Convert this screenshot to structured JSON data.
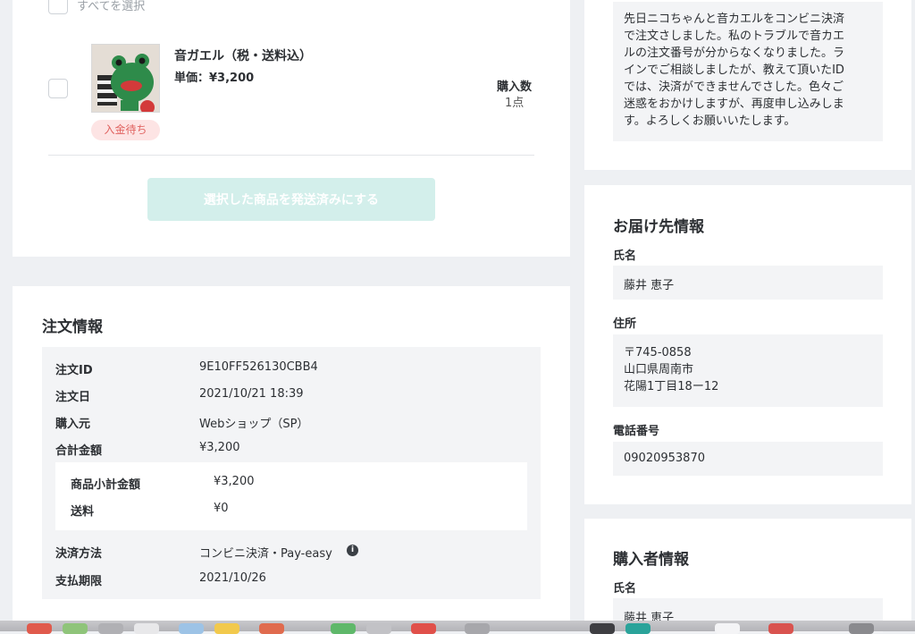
{
  "cart": {
    "select_all_label": "すべてを選択",
    "item": {
      "name": "音ガエル（税・送料込）",
      "unit_price": "単価：¥3,200",
      "quantity_label": "購入数",
      "quantity_value": "1点",
      "status_badge": "入金待ち"
    },
    "mark_shipped_button": "選択した商品を発送済みにする"
  },
  "order_info": {
    "title": "注文情報",
    "rows": [
      {
        "label": "注文ID",
        "value": "9E10FF526130CBB4"
      },
      {
        "label": "注文日",
        "value": "2021/10/21 18:39"
      },
      {
        "label": "購入元",
        "value": "Webショップ（SP）"
      },
      {
        "label": "合計金額",
        "value": "¥3,200"
      }
    ],
    "sub_rows": [
      {
        "label": "商品小計金額",
        "value": "¥3,200"
      },
      {
        "label": "送料",
        "value": "¥0"
      }
    ],
    "payment_label": "決済方法",
    "payment_value": "コンビニ決済・Pay-easy",
    "deadline_label": "支払期限",
    "deadline_value": "2021/10/26"
  },
  "message": {
    "lines": [
      "先日ニコちゃんと音カエルをコンビニ決済",
      "で注文さしました。私のトラブルで音カエ",
      "ルの注文番号が分からなくなりました。ラ",
      "インでご相談しましたが、教えて頂いたID",
      "では、決済ができませんでさした。色々ご",
      "迷惑をおかけしますが、再度申し込みしま",
      "す。よろしくお願いいたします。"
    ]
  },
  "delivery": {
    "title": "お届け先情報",
    "name_label": "氏名",
    "name_value": "藤井 恵子",
    "address_label": "住所",
    "address_lines": [
      "〒745-0858",
      "山口県周南市",
      "花陽1丁目18ー12"
    ],
    "phone_label": "電話番号",
    "phone_value": "09020953870"
  },
  "purchaser": {
    "title": "購入者情報",
    "name_label": "氏名",
    "name_value": "藤井 恵子"
  },
  "colors": {
    "accent_disabled": "#d3efeb",
    "badge_bg": "#fde4e4",
    "badge_text": "#e0625f"
  }
}
